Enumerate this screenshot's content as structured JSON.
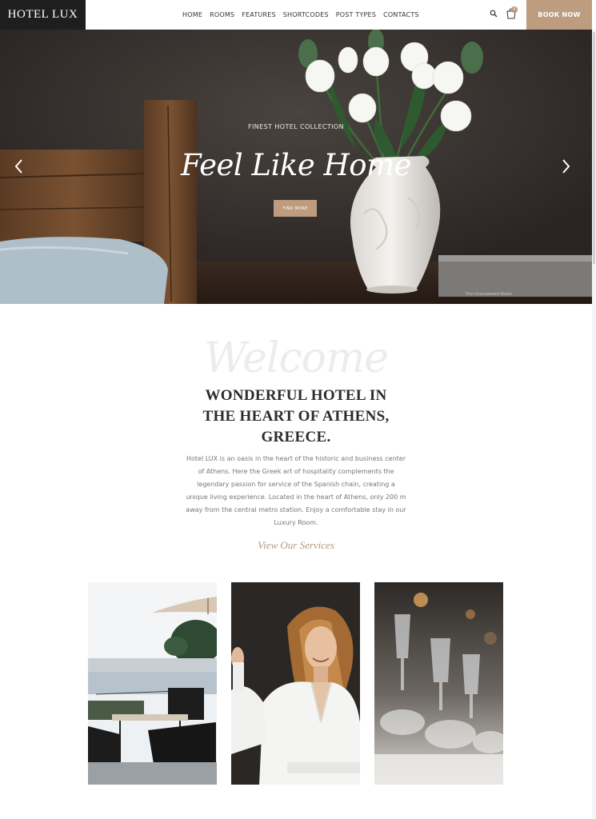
{
  "header": {
    "logo": "HOTEL LUX",
    "nav": [
      "HOME",
      "ROOMS",
      "FEATURES",
      "SHORTCODES",
      "POST TYPES",
      "CONTACTS"
    ],
    "cart_count": "0",
    "book_label": "BOOK NOW",
    "icons": [
      "search-icon",
      "cart-icon"
    ]
  },
  "hero": {
    "subtitle": "FINEST HOTEL COLLECTION",
    "title": "Feel Like Home",
    "button": "FIND MORE",
    "book_spine_text": "The Unanswered Room"
  },
  "welcome": {
    "script": "Welcome",
    "title_lines": [
      "WONDERFUL HOTEL IN",
      "THE HEART OF ATHENS,",
      "GREECE."
    ],
    "body": "Hotel LUX is an oasis in the heart of the historic and business center of Athens. Here the Greek art of hospitality complements the legendary passion for service of the Spanish chain, creating a unique living experience. Located in the heart of Athens, only 200 m away from the central metro station. Enjoy a comfortable stay in our Luxury Room.",
    "link": "View Our Services"
  },
  "colors": {
    "accent": "#bd9c80",
    "dark": "#1e1e1e",
    "link": "#b39978"
  }
}
